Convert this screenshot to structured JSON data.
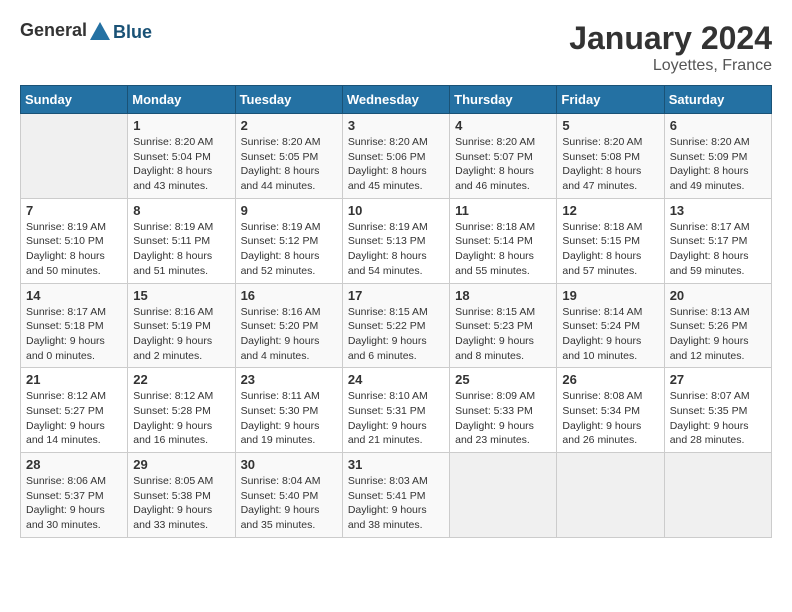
{
  "header": {
    "logo_general": "General",
    "logo_blue": "Blue",
    "month_title": "January 2024",
    "location": "Loyettes, France"
  },
  "weekdays": [
    "Sunday",
    "Monday",
    "Tuesday",
    "Wednesday",
    "Thursday",
    "Friday",
    "Saturday"
  ],
  "weeks": [
    [
      {
        "day": "",
        "sunrise": "",
        "sunset": "",
        "daylight": ""
      },
      {
        "day": "1",
        "sunrise": "Sunrise: 8:20 AM",
        "sunset": "Sunset: 5:04 PM",
        "daylight": "Daylight: 8 hours and 43 minutes."
      },
      {
        "day": "2",
        "sunrise": "Sunrise: 8:20 AM",
        "sunset": "Sunset: 5:05 PM",
        "daylight": "Daylight: 8 hours and 44 minutes."
      },
      {
        "day": "3",
        "sunrise": "Sunrise: 8:20 AM",
        "sunset": "Sunset: 5:06 PM",
        "daylight": "Daylight: 8 hours and 45 minutes."
      },
      {
        "day": "4",
        "sunrise": "Sunrise: 8:20 AM",
        "sunset": "Sunset: 5:07 PM",
        "daylight": "Daylight: 8 hours and 46 minutes."
      },
      {
        "day": "5",
        "sunrise": "Sunrise: 8:20 AM",
        "sunset": "Sunset: 5:08 PM",
        "daylight": "Daylight: 8 hours and 47 minutes."
      },
      {
        "day": "6",
        "sunrise": "Sunrise: 8:20 AM",
        "sunset": "Sunset: 5:09 PM",
        "daylight": "Daylight: 8 hours and 49 minutes."
      }
    ],
    [
      {
        "day": "7",
        "sunrise": "Sunrise: 8:19 AM",
        "sunset": "Sunset: 5:10 PM",
        "daylight": "Daylight: 8 hours and 50 minutes."
      },
      {
        "day": "8",
        "sunrise": "Sunrise: 8:19 AM",
        "sunset": "Sunset: 5:11 PM",
        "daylight": "Daylight: 8 hours and 51 minutes."
      },
      {
        "day": "9",
        "sunrise": "Sunrise: 8:19 AM",
        "sunset": "Sunset: 5:12 PM",
        "daylight": "Daylight: 8 hours and 52 minutes."
      },
      {
        "day": "10",
        "sunrise": "Sunrise: 8:19 AM",
        "sunset": "Sunset: 5:13 PM",
        "daylight": "Daylight: 8 hours and 54 minutes."
      },
      {
        "day": "11",
        "sunrise": "Sunrise: 8:18 AM",
        "sunset": "Sunset: 5:14 PM",
        "daylight": "Daylight: 8 hours and 55 minutes."
      },
      {
        "day": "12",
        "sunrise": "Sunrise: 8:18 AM",
        "sunset": "Sunset: 5:15 PM",
        "daylight": "Daylight: 8 hours and 57 minutes."
      },
      {
        "day": "13",
        "sunrise": "Sunrise: 8:17 AM",
        "sunset": "Sunset: 5:17 PM",
        "daylight": "Daylight: 8 hours and 59 minutes."
      }
    ],
    [
      {
        "day": "14",
        "sunrise": "Sunrise: 8:17 AM",
        "sunset": "Sunset: 5:18 PM",
        "daylight": "Daylight: 9 hours and 0 minutes."
      },
      {
        "day": "15",
        "sunrise": "Sunrise: 8:16 AM",
        "sunset": "Sunset: 5:19 PM",
        "daylight": "Daylight: 9 hours and 2 minutes."
      },
      {
        "day": "16",
        "sunrise": "Sunrise: 8:16 AM",
        "sunset": "Sunset: 5:20 PM",
        "daylight": "Daylight: 9 hours and 4 minutes."
      },
      {
        "day": "17",
        "sunrise": "Sunrise: 8:15 AM",
        "sunset": "Sunset: 5:22 PM",
        "daylight": "Daylight: 9 hours and 6 minutes."
      },
      {
        "day": "18",
        "sunrise": "Sunrise: 8:15 AM",
        "sunset": "Sunset: 5:23 PM",
        "daylight": "Daylight: 9 hours and 8 minutes."
      },
      {
        "day": "19",
        "sunrise": "Sunrise: 8:14 AM",
        "sunset": "Sunset: 5:24 PM",
        "daylight": "Daylight: 9 hours and 10 minutes."
      },
      {
        "day": "20",
        "sunrise": "Sunrise: 8:13 AM",
        "sunset": "Sunset: 5:26 PM",
        "daylight": "Daylight: 9 hours and 12 minutes."
      }
    ],
    [
      {
        "day": "21",
        "sunrise": "Sunrise: 8:12 AM",
        "sunset": "Sunset: 5:27 PM",
        "daylight": "Daylight: 9 hours and 14 minutes."
      },
      {
        "day": "22",
        "sunrise": "Sunrise: 8:12 AM",
        "sunset": "Sunset: 5:28 PM",
        "daylight": "Daylight: 9 hours and 16 minutes."
      },
      {
        "day": "23",
        "sunrise": "Sunrise: 8:11 AM",
        "sunset": "Sunset: 5:30 PM",
        "daylight": "Daylight: 9 hours and 19 minutes."
      },
      {
        "day": "24",
        "sunrise": "Sunrise: 8:10 AM",
        "sunset": "Sunset: 5:31 PM",
        "daylight": "Daylight: 9 hours and 21 minutes."
      },
      {
        "day": "25",
        "sunrise": "Sunrise: 8:09 AM",
        "sunset": "Sunset: 5:33 PM",
        "daylight": "Daylight: 9 hours and 23 minutes."
      },
      {
        "day": "26",
        "sunrise": "Sunrise: 8:08 AM",
        "sunset": "Sunset: 5:34 PM",
        "daylight": "Daylight: 9 hours and 26 minutes."
      },
      {
        "day": "27",
        "sunrise": "Sunrise: 8:07 AM",
        "sunset": "Sunset: 5:35 PM",
        "daylight": "Daylight: 9 hours and 28 minutes."
      }
    ],
    [
      {
        "day": "28",
        "sunrise": "Sunrise: 8:06 AM",
        "sunset": "Sunset: 5:37 PM",
        "daylight": "Daylight: 9 hours and 30 minutes."
      },
      {
        "day": "29",
        "sunrise": "Sunrise: 8:05 AM",
        "sunset": "Sunset: 5:38 PM",
        "daylight": "Daylight: 9 hours and 33 minutes."
      },
      {
        "day": "30",
        "sunrise": "Sunrise: 8:04 AM",
        "sunset": "Sunset: 5:40 PM",
        "daylight": "Daylight: 9 hours and 35 minutes."
      },
      {
        "day": "31",
        "sunrise": "Sunrise: 8:03 AM",
        "sunset": "Sunset: 5:41 PM",
        "daylight": "Daylight: 9 hours and 38 minutes."
      },
      {
        "day": "",
        "sunrise": "",
        "sunset": "",
        "daylight": ""
      },
      {
        "day": "",
        "sunrise": "",
        "sunset": "",
        "daylight": ""
      },
      {
        "day": "",
        "sunrise": "",
        "sunset": "",
        "daylight": ""
      }
    ]
  ]
}
